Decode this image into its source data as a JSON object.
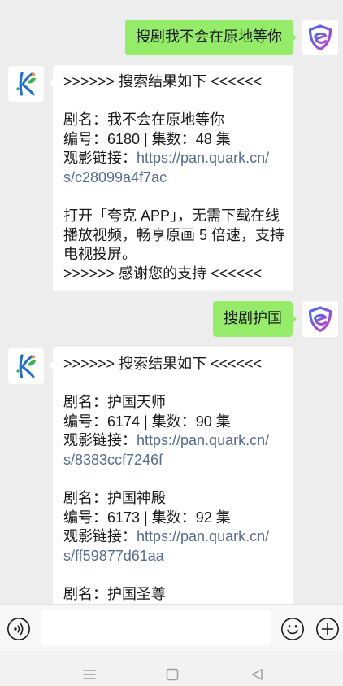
{
  "theme": {
    "chat_background": "#ededed",
    "sent_bubble": "#95ec69",
    "received_bubble": "#ffffff",
    "message_text": "#1a1a1a",
    "link": "#576b95",
    "input_bar_background": "#f7f7f7",
    "nav_bar_background": "#f2f2f2"
  },
  "chat": {
    "messages": [
      {
        "avatar_icon": "shield-logo-icon",
        "text": "搜剧我不会在原地等你"
      },
      {
        "avatar_icon": "k-leaf-logo-icon",
        "header": ">>>>>> 搜索结果如下 <<<<<<",
        "results": [
          {
            "title": "剧名：我不会在原地等你",
            "info": "编号：6180 | 集数：48 集",
            "link_label": "观影链接：",
            "link_lines": [
              "https://pan.quark.cn/",
              "s/c28099a4f7ac"
            ]
          }
        ],
        "notice_lines": [
          "打开「夸克 APP」，无需下载在线",
          "播放视频，畅享原画 5 倍速，支持",
          "电视投屏。"
        ],
        "footer": ">>>>>> 感谢您的支持 <<<<<<"
      },
      {
        "avatar_icon": "shield-logo-icon",
        "text": "搜剧护国"
      },
      {
        "avatar_icon": "k-leaf-logo-icon",
        "header": ">>>>>> 搜索结果如下 <<<<<<",
        "results": [
          {
            "title": "剧名：护国天师",
            "info": "编号：6174 | 集数：90 集",
            "link_label": "观影链接：",
            "link_lines": [
              "https://pan.quark.cn/",
              "s/8383ccf7246f"
            ]
          },
          {
            "title": "剧名：护国神殿",
            "info": "编号：6173 | 集数：92 集",
            "link_label": "观影链接：",
            "link_lines": [
              "https://pan.quark.cn/",
              "s/ff59877d61aa"
            ]
          },
          {
            "title": "剧名：护国圣尊"
          }
        ]
      }
    ]
  },
  "input_bar": {
    "voice_icon": "voice-icon",
    "value": "",
    "emoji_icon": "emoji-icon",
    "more_icon": "plus-circle-icon"
  },
  "nav_bar": {
    "recent_icon": "menu-icon",
    "home_icon": "home-square-icon",
    "back_icon": "back-triangle-icon"
  }
}
